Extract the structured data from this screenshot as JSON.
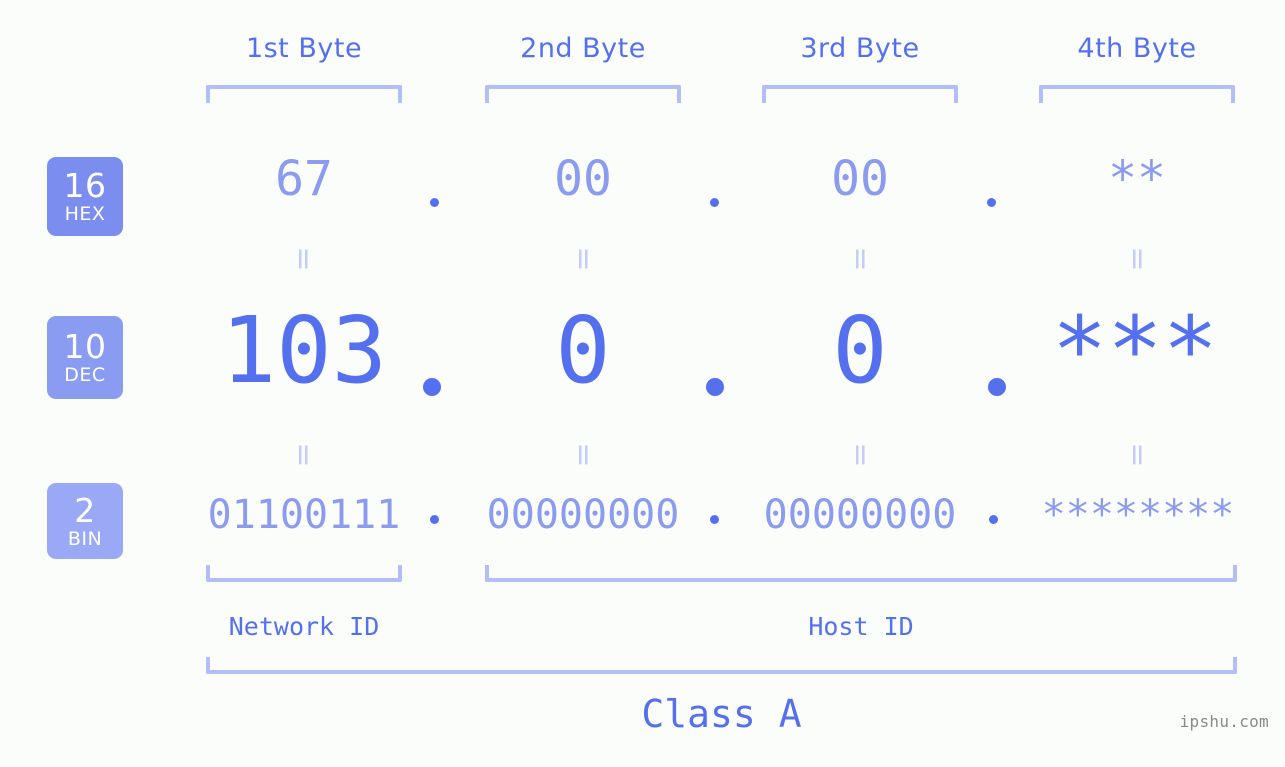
{
  "bases": [
    {
      "num": "16",
      "name": "HEX"
    },
    {
      "num": "10",
      "name": "DEC"
    },
    {
      "num": "2",
      "name": "BIN"
    }
  ],
  "byte_headers": [
    {
      "label": "1st Byte"
    },
    {
      "label": "2nd Byte"
    },
    {
      "label": "3rd Byte"
    },
    {
      "label": "4th Byte"
    }
  ],
  "rows": {
    "hex": {
      "values": [
        "67",
        "00",
        "00",
        "**"
      ]
    },
    "dec": {
      "values": [
        "103",
        "0",
        "0",
        "***"
      ]
    },
    "bin": {
      "values": [
        "01100111",
        "00000000",
        "00000000",
        "********"
      ]
    }
  },
  "equals": {
    "symbol": "=",
    "hex_to_dec": [
      "=",
      "=",
      "=",
      "="
    ],
    "dec_to_bin": [
      "=",
      "=",
      "=",
      "="
    ]
  },
  "separators": {
    "hex": [
      ".",
      ".",
      "."
    ],
    "dec": [
      ".",
      ".",
      "."
    ],
    "bin": [
      ".",
      ".",
      "."
    ]
  },
  "regions": {
    "network_id": "Network ID",
    "host_id": "Host ID",
    "class": "Class A"
  },
  "watermark": "ipshu.com",
  "colors": {
    "background": "#fbfdfa",
    "accent_strong": "#5570ee",
    "accent_light": "#8b9bf0",
    "bracket": "#b3bdf7",
    "equals": "#c4ccf9",
    "badge_hex": "#7b8ef0",
    "badge_dec": "#8a9bf2",
    "badge_bin": "#9aa9f5",
    "watermark": "#8a8a8a"
  }
}
